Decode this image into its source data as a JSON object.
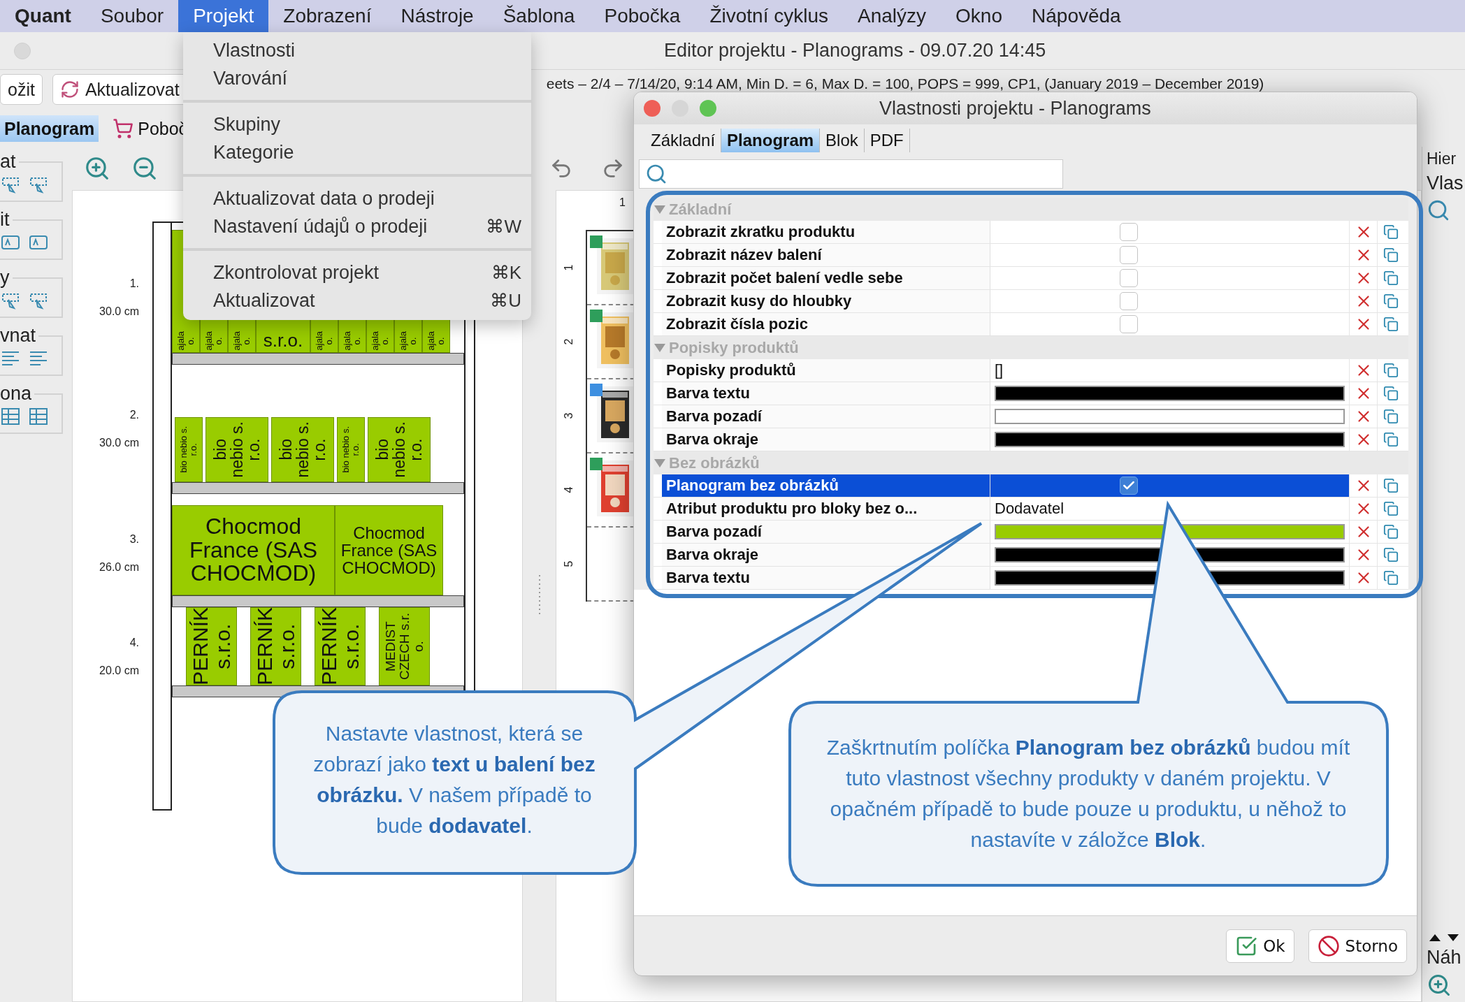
{
  "menu_bar": {
    "items": [
      {
        "label": "Quant",
        "kind": "app",
        "selected": false
      },
      {
        "label": "Soubor",
        "kind": "menu",
        "selected": false
      },
      {
        "label": "Projekt",
        "kind": "menu",
        "selected": true
      },
      {
        "label": "Zobrazení",
        "kind": "menu",
        "selected": false
      },
      {
        "label": "Nástroje",
        "kind": "menu",
        "selected": false
      },
      {
        "label": "Šablona",
        "kind": "menu",
        "selected": false
      },
      {
        "label": "Pobočka",
        "kind": "menu",
        "selected": false
      },
      {
        "label": "Životní cyklus",
        "kind": "menu",
        "selected": false
      },
      {
        "label": "Analýzy",
        "kind": "menu",
        "selected": false
      },
      {
        "label": "Okno",
        "kind": "menu",
        "selected": false
      },
      {
        "label": "Nápověda",
        "kind": "menu",
        "selected": false
      }
    ]
  },
  "main_window": {
    "title": "Editor projektu - Planograms - 09.07.20 14:45",
    "toolbar": {
      "buttons": [
        "ožit",
        "Aktualizovat"
      ],
      "info": "eets – 2/4 – 7/14/20, 9:14 AM, Min D. = 6, Max D. = 100, POPS = 999, CP1, (January 2019 – December 2019)"
    },
    "tabs": [
      {
        "label": "Planogram",
        "selected": true
      },
      {
        "label": "Poboč",
        "selected": false
      }
    ],
    "left_panel": {
      "groups": [
        "at",
        "it",
        "y",
        "vnat",
        "ona"
      ]
    },
    "planogram": {
      "shelves": [
        {
          "number": "1.",
          "height": "30.0 cm",
          "products": [
            {
              "kind": "narrow",
              "lines": [
                "ajala",
                "o."
              ]
            },
            {
              "kind": "narrow",
              "lines": [
                "ajala",
                "o."
              ]
            },
            {
              "kind": "narrow",
              "lines": [
                "ajala",
                "o."
              ]
            },
            {
              "kind": "wide_h",
              "lines": [
                "s.r.o."
              ]
            },
            {
              "kind": "narrow",
              "lines": [
                "ajala",
                "o."
              ]
            },
            {
              "kind": "narrow",
              "lines": [
                "ajala",
                "o."
              ]
            },
            {
              "kind": "narrow",
              "lines": [
                "ajala",
                "o."
              ]
            },
            {
              "kind": "narrow",
              "lines": [
                "ajala",
                "o."
              ]
            },
            {
              "kind": "narrow",
              "lines": [
                "ajala",
                "o."
              ]
            }
          ]
        },
        {
          "number": "2.",
          "height": "30.0 cm",
          "products": [
            {
              "kind": "narrow",
              "lines": [
                "bio nebio s.",
                "r.o."
              ]
            },
            {
              "kind": "wide",
              "lines": [
                "bio",
                "nebio s.",
                "r.o."
              ]
            },
            {
              "kind": "wide",
              "lines": [
                "bio",
                "nebio s.",
                "r.o."
              ]
            },
            {
              "kind": "narrow",
              "lines": [
                "bio nebio s.",
                "r.o."
              ]
            },
            {
              "kind": "wide",
              "lines": [
                "bio",
                "nebio s.",
                "r.o."
              ]
            }
          ]
        },
        {
          "number": "3.",
          "height": "26.0 cm",
          "products": [
            {
              "kind": "block",
              "lines": [
                "Chocmod",
                "France (SAS",
                "CHOCMOD)"
              ]
            },
            {
              "kind": "block_small",
              "lines": [
                "Chocmod",
                "France (SAS",
                "CHOCMOD)"
              ]
            }
          ]
        },
        {
          "number": "4.",
          "height": "20.0 cm",
          "products": [
            {
              "kind": "tall",
              "lines": [
                "PERNÍK",
                "s.r.o."
              ]
            },
            {
              "kind": "tall",
              "lines": [
                "PERNÍK",
                "s.r.o."
              ]
            },
            {
              "kind": "tall",
              "lines": [
                "PERNÍK",
                "s.r.o."
              ]
            },
            {
              "kind": "tall_small",
              "lines": [
                "MEDIST",
                "CZECH s.r.",
                "o."
              ]
            }
          ]
        }
      ]
    },
    "layout_view": {
      "column": "1",
      "positions": [
        {
          "number": "1",
          "color": "#2e9e5b"
        },
        {
          "number": "2",
          "color": "#2e9e5b"
        },
        {
          "number": "3",
          "color": "#3d8fe0"
        },
        {
          "number": "4",
          "color": "#2e9e5b"
        },
        {
          "number": "5"
        }
      ]
    },
    "right_panel": {
      "title": "Hier",
      "tab": "Vlas",
      "bottom_title": "Náh"
    }
  },
  "project_menu": {
    "sections": [
      [
        {
          "label": "Vlastnosti"
        },
        {
          "label": "Varování"
        }
      ],
      [
        {
          "label": "Skupiny"
        },
        {
          "label": "Kategorie"
        }
      ],
      [
        {
          "label": "Aktualizovat data o prodeji"
        },
        {
          "label": "Nastavení údajů o prodeji",
          "shortcut": "⌘W"
        }
      ],
      [
        {
          "label": "Zkontrolovat projekt",
          "shortcut": "⌘K"
        },
        {
          "label": "Aktualizovat",
          "shortcut": "⌘U"
        }
      ]
    ]
  },
  "dialog": {
    "title": "Vlastnosti projektu - Planograms",
    "tabs": [
      {
        "label": "Základní",
        "selected": false
      },
      {
        "label": "Planogram",
        "selected": true
      },
      {
        "label": "Blok",
        "selected": false
      },
      {
        "label": "PDF",
        "selected": false
      }
    ],
    "groups": [
      {
        "title": "Základní",
        "expanded": true,
        "rows": [
          {
            "label": "Zobrazit zkratku produktu",
            "kind": "checkbox",
            "checked": false,
            "selected": false
          },
          {
            "label": "Zobrazit název balení",
            "kind": "checkbox",
            "checked": false,
            "selected": false
          },
          {
            "label": "Zobrazit počet balení vedle sebe",
            "kind": "checkbox",
            "checked": false,
            "selected": false
          },
          {
            "label": "Zobrazit kusy do hloubky",
            "kind": "checkbox",
            "checked": false,
            "selected": false
          },
          {
            "label": "Zobrazit čísla pozic",
            "kind": "checkbox",
            "checked": false,
            "selected": false
          }
        ]
      },
      {
        "title": "Popisky produktů",
        "expanded": true,
        "rows": [
          {
            "label": "Popisky produktů",
            "kind": "text",
            "value": "[]",
            "selected": false
          },
          {
            "label": "Barva textu",
            "kind": "color",
            "color": "#000000",
            "selected": false
          },
          {
            "label": "Barva pozadí",
            "kind": "color",
            "color": "#ffffff",
            "selected": false
          },
          {
            "label": "Barva okraje",
            "kind": "color",
            "color": "#000000",
            "selected": false
          }
        ]
      },
      {
        "title": "Bez obrázků",
        "expanded": true,
        "rows": [
          {
            "label": "Planogram bez obrázků",
            "kind": "checkbox",
            "checked": true,
            "selected": true
          },
          {
            "label": "Atribut produktu pro bloky bez o...",
            "kind": "text",
            "value": "Dodavatel",
            "selected": false
          },
          {
            "label": "Barva pozadí",
            "kind": "color",
            "color": "#99cc00",
            "selected": false
          },
          {
            "label": "Barva okraje",
            "kind": "color",
            "color": "#000000",
            "selected": false
          },
          {
            "label": "Barva textu",
            "kind": "color",
            "color": "#000000",
            "selected": false
          }
        ]
      }
    ],
    "buttons": [
      {
        "label": "Ok",
        "kind": "ok"
      },
      {
        "label": "Storno",
        "kind": "cancel"
      }
    ]
  },
  "callouts": [
    {
      "text": "Nastavte vlastnost, která se zobrazí jako **text u balení bez obrázku.** V našem případě to bude **dodavatel**."
    },
    {
      "text": "Zaškrtnutím políčka **Planogram bez obrázků** budou mít tuto vlastnost všechny produkty v daném projektu. V opačném případě to bude pouze u produktu, u něhož to nastavíte v záložce **Blok**."
    }
  ]
}
